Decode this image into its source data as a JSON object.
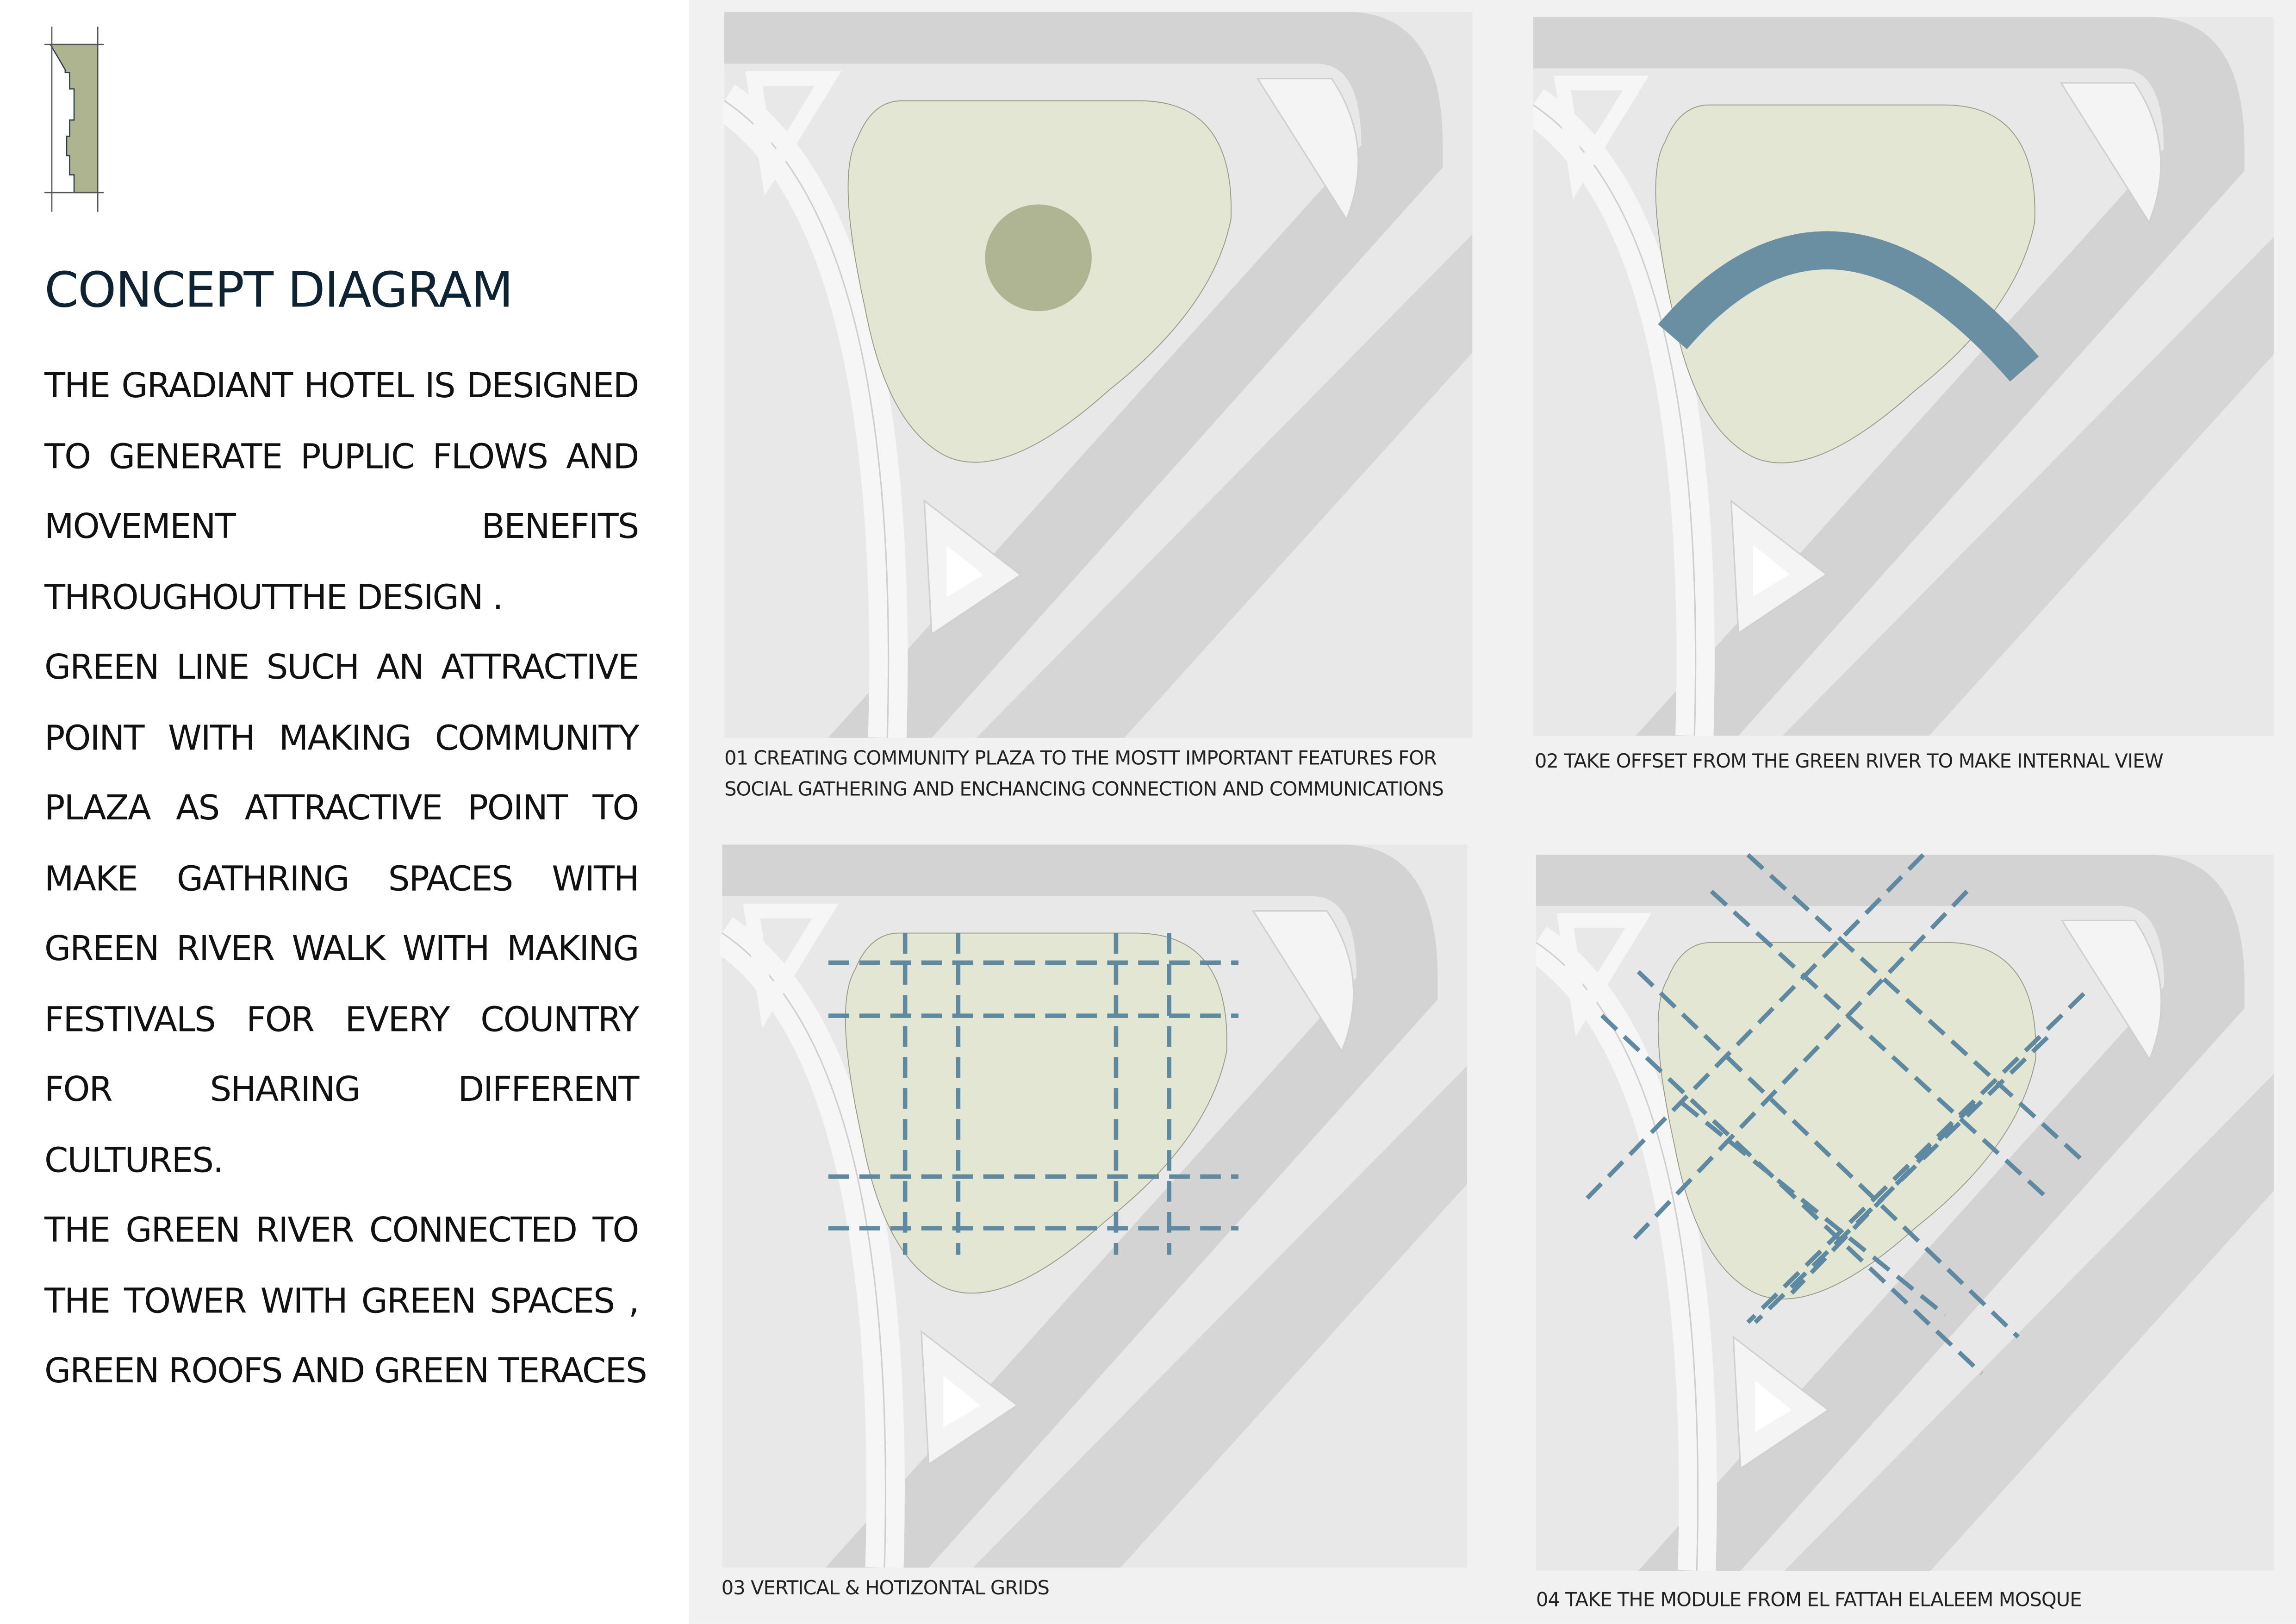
{
  "heading": {
    "title": "CONCEPT DIAGRAM"
  },
  "description_lines": [
    {
      "text": "THE GRADIANT HOTEL IS DESIGNED",
      "justify": true
    },
    {
      "text": "TO GENERATE PUPLIC FLOWS AND",
      "justify": true
    },
    {
      "text": "MOVEMENT BENEFITS",
      "justify": true
    },
    {
      "text": "THROUGHOUTTHE DESIGN .",
      "justify": false
    },
    {
      "text": "GREEN LINE SUCH AN ATTRACTIVE",
      "justify": true
    },
    {
      "text": "POINT WITH MAKING COMMUNITY",
      "justify": true
    },
    {
      "text": "PLAZA AS ATTRACTIVE POINT TO",
      "justify": true
    },
    {
      "text": "MAKE GATHRING SPACES WITH",
      "justify": true
    },
    {
      "text": "GREEN RIVER WALK WITH MAKING",
      "justify": true
    },
    {
      "text": "FESTIVALS FOR EVERY COUNTRY",
      "justify": true
    },
    {
      "text": "FOR SHARING DIFFERENT",
      "justify": true
    },
    {
      "text": "CULTURES.",
      "justify": false
    },
    {
      "text": "THE GREEN RIVER CONNECTED TO",
      "justify": true
    },
    {
      "text": "THE TOWER WITH GREEN SPACES ,",
      "justify": true
    },
    {
      "text": "GREEN ROOFS AND GREEN TERACES",
      "justify": true
    }
  ],
  "top_cut_text": "MAKE INTERNAL VIEW",
  "panels": [
    {
      "caption_lines": [
        "01 CREATING COMMUNITY PLAZA TO THE MOSTT IMPORTANT FEATURES FOR",
        "SOCIAL GATHERING AND ENCHANCING CONNECTION AND COMMUNICATIONS"
      ]
    },
    {
      "caption_lines": [
        "02 TAKE OFFSET FROM THE GREEN RIVER TO MAKE INTERNAL VIEW"
      ]
    },
    {
      "caption_lines": [
        "03 VERTICAL & HOTIZONTAL GRIDS"
      ]
    },
    {
      "caption_lines": [
        "04 TAKE THE MODULE FROM EL FATTAH ELALEEM MOSQUE"
      ]
    }
  ],
  "colors": {
    "plaza": "#e3e6d3",
    "circle": "#afb593",
    "river": "#6a8fa3",
    "grid": "#5f89a1",
    "logo": "#aeb48f",
    "title": "#0f2231"
  }
}
